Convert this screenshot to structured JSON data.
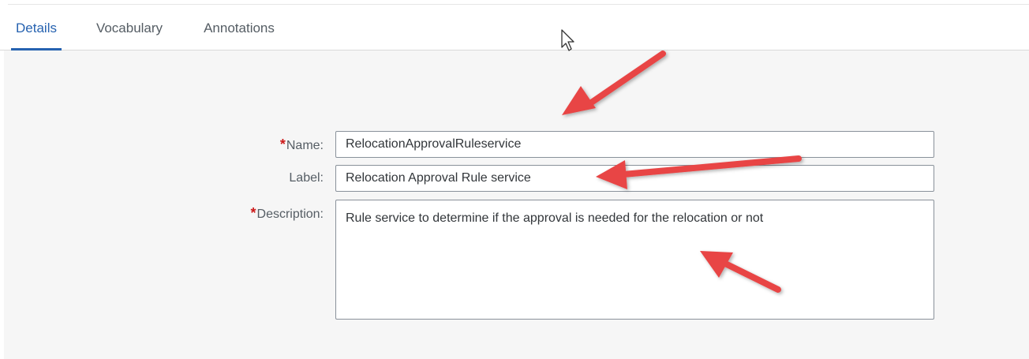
{
  "tabs": [
    {
      "label": "Details",
      "active": true
    },
    {
      "label": "Vocabulary",
      "active": false
    },
    {
      "label": "Annotations",
      "active": false
    }
  ],
  "form": {
    "name": {
      "label": "Name:",
      "required": true,
      "value": "RelocationApprovalRuleservice"
    },
    "label": {
      "label": "Label:",
      "required": false,
      "value": "Relocation Approval Rule service"
    },
    "description": {
      "label": "Description:",
      "required": true,
      "value": "Rule service to determine if the approval is needed for the relocation or not"
    }
  },
  "colors": {
    "accent": "#2662b0",
    "required": "#cc1919",
    "annotation_arrow": "#e84545"
  },
  "icons": {
    "cursor": "mouse-pointer-icon",
    "arrows": "annotation-arrow-icon"
  }
}
